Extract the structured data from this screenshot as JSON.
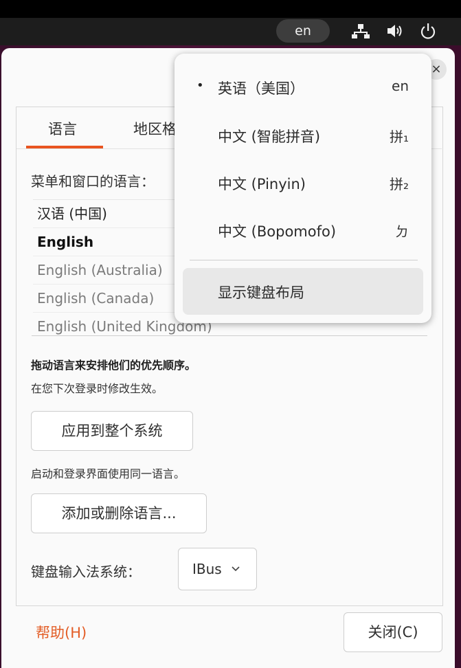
{
  "topbar": {
    "input_indicator": "en",
    "network_icon": "network-icon",
    "volume_icon": "volume-icon",
    "power_icon": "power-icon"
  },
  "dialog": {
    "close_glyph": "×",
    "tabs": [
      {
        "label": "语言",
        "active": true
      },
      {
        "label": "地区格式",
        "active": false
      }
    ],
    "menu_language_label": "菜单和窗口的语言：",
    "languages": [
      {
        "label": "汉语 (中国)",
        "style": "dark"
      },
      {
        "label": "English",
        "style": "bold"
      },
      {
        "label": "English (Australia)",
        "style": "dim"
      },
      {
        "label": "English (Canada)",
        "style": "dim"
      },
      {
        "label": "English (United Kingdom)",
        "style": "dim"
      }
    ],
    "drag_hint": "拖动语言来安排他们的优先顺序。",
    "next_login_hint": "在您下次登录时修改生效。",
    "apply_system_button": "应用到整个系统",
    "startup_hint": "启动和登录界面使用同一语言。",
    "add_remove_button": "添加或删除语言...",
    "keyboard_input_label": "键盘输入法系统：",
    "keyboard_input_value": "IBus",
    "help_button": "帮助(H)",
    "close_button": "关闭(C)"
  },
  "input_menu": {
    "items": [
      {
        "label": "英语（美国）",
        "key": "en",
        "selected": true
      },
      {
        "label": "中文 (智能拼音)",
        "key": "拼₁",
        "selected": false
      },
      {
        "label": "中文 (Pinyin)",
        "key": "拼₂",
        "selected": false
      },
      {
        "label": "中文 (Bopomofo)",
        "key": "ㄉ",
        "selected": false
      }
    ],
    "bullet": "•",
    "show_layout": "显示键盘布局"
  },
  "colors": {
    "accent": "#e95420",
    "help_text": "#e35d26",
    "panel": "#1d1d1d"
  }
}
